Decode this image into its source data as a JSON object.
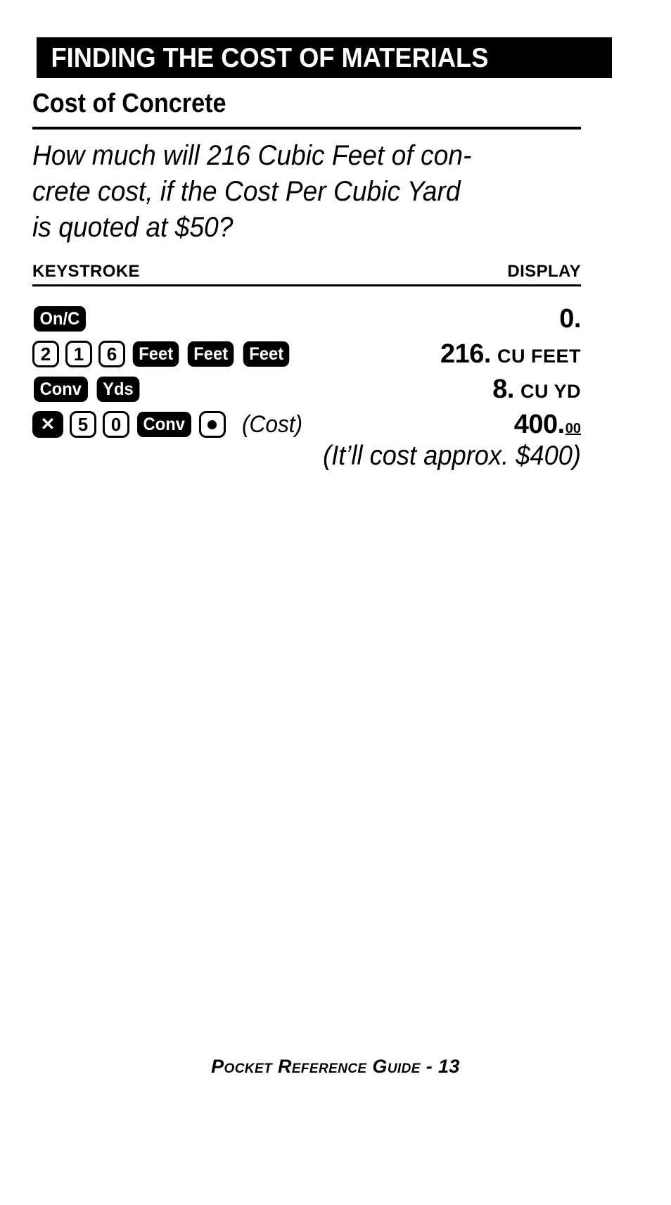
{
  "banner": {
    "title": "FINDING THE COST OF MATERIALS"
  },
  "section": {
    "heading": "Cost of Concrete"
  },
  "question": {
    "line1": "How much will 216 Cubic Feet of con-",
    "line2": "crete cost, if the Cost Per Cubic Yard",
    "line3": "is quoted at $50?"
  },
  "columns": {
    "keystroke_header": "KEYSTROKE",
    "display_header": "DISPLAY"
  },
  "rows": [
    {
      "keys": [
        {
          "label": "On/C",
          "type": "fn",
          "icon": "onc-key"
        }
      ],
      "note": "",
      "display": {
        "value": "0.",
        "unit": "",
        "sup": ""
      }
    },
    {
      "keys": [
        {
          "label": "2",
          "type": "num",
          "icon": "digit-2-key"
        },
        {
          "label": "1",
          "type": "num",
          "icon": "digit-1-key"
        },
        {
          "label": "6",
          "type": "num",
          "icon": "digit-6-key"
        },
        {
          "label": "Feet",
          "type": "fn",
          "icon": "feet-key"
        },
        {
          "label": "Feet",
          "type": "fn",
          "icon": "feet-key"
        },
        {
          "label": "Feet",
          "type": "fn",
          "icon": "feet-key"
        }
      ],
      "note": "",
      "display": {
        "value": "216.",
        "unit": "CU FEET",
        "sup": ""
      }
    },
    {
      "keys": [
        {
          "label": "Conv",
          "type": "fn",
          "icon": "conv-key"
        },
        {
          "label": "Yds",
          "type": "fn",
          "icon": "yds-key"
        }
      ],
      "note": "",
      "display": {
        "value": "8.",
        "unit": "CU YD",
        "sup": ""
      }
    },
    {
      "keys": [
        {
          "label": "✕",
          "type": "op",
          "icon": "multiply-key"
        },
        {
          "label": "5",
          "type": "num",
          "icon": "digit-5-key"
        },
        {
          "label": "0",
          "type": "num",
          "icon": "digit-0-key"
        },
        {
          "label": "Conv",
          "type": "fn",
          "icon": "conv-key"
        },
        {
          "label": "",
          "type": "dot",
          "icon": "decimal-point-key"
        }
      ],
      "note": "(Cost)",
      "display": {
        "value": "400.",
        "unit": "",
        "sup": "00"
      }
    }
  ],
  "aside": {
    "text": "(It’ll cost approx. $400)"
  },
  "footer": {
    "text": "Pocket Reference Guide - 13"
  },
  "colors": {
    "ink": "#000000",
    "paper": "#ffffff"
  }
}
